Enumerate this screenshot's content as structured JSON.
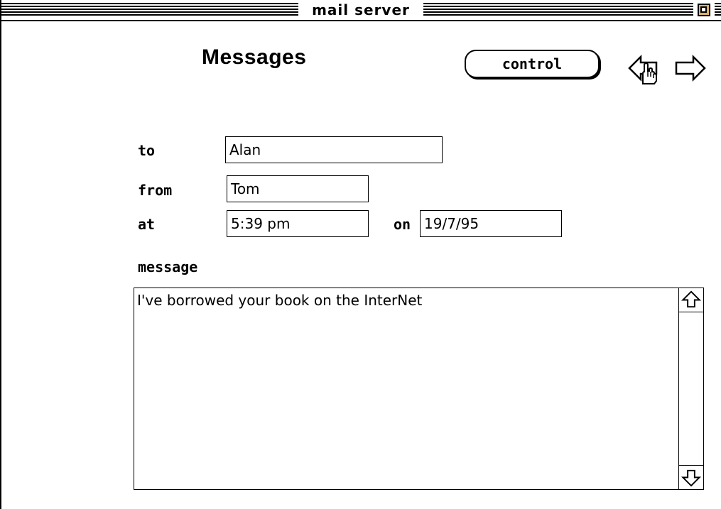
{
  "window": {
    "title": "mail server"
  },
  "header": {
    "title": "Messages",
    "control_label": "control",
    "back_icon": "back-arrow-with-hand-icon",
    "forward_icon": "forward-arrow-icon"
  },
  "form": {
    "to_label": "to",
    "to_value": "Alan",
    "from_label": "from",
    "from_value": "Tom",
    "at_label": "at",
    "at_value": "5:39 pm",
    "on_label": "on",
    "on_value": "19/7/95",
    "message_label": "message",
    "message_value": "I've borrowed your book on the InterNet"
  },
  "colors": {
    "background": "#ffffff",
    "foreground": "#000000",
    "zoom_box": "#d9b26a"
  }
}
